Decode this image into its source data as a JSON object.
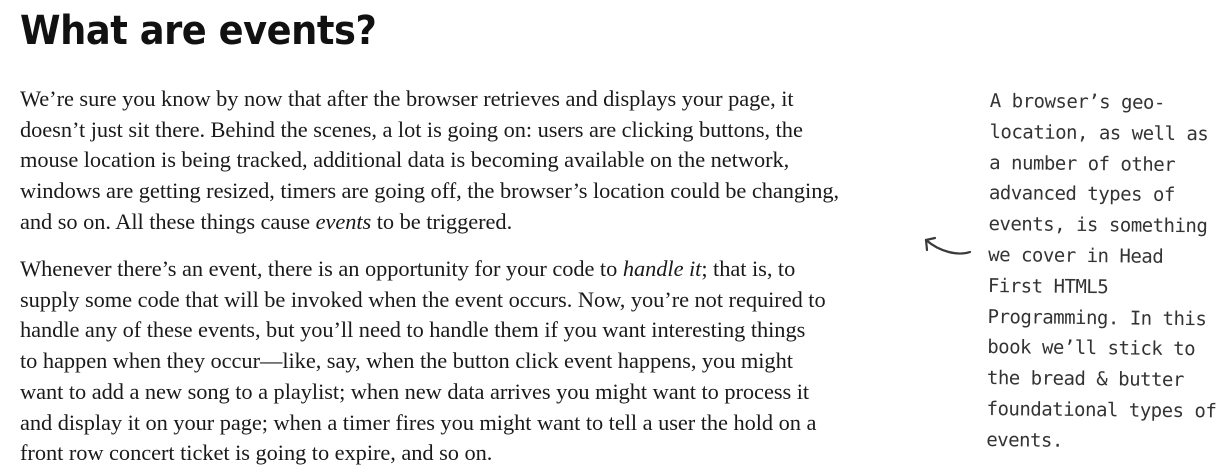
{
  "page": {
    "title": "What are events?"
  },
  "paragraph_1": {
    "lines": [
      "We’re sure you know by now that after the browser retrieves and displays your page, it",
      "doesn’t just sit there. Behind the scenes, a lot is going on: users are clicking buttons, the",
      "mouse location is being tracked, additional data is becoming available on the network,",
      "windows are getting resized, timers are going off, the browser’s location could be changing,"
    ],
    "last_line_before": "and so on. All these things cause ",
    "last_line_emphasis": "events",
    "last_line_after": " to be triggered."
  },
  "paragraph_2": {
    "first_line_before": "Whenever there’s an event, there is an opportunity for your code to ",
    "first_line_emphasis": "handle it",
    "first_line_after": "; that is, to",
    "lines": [
      "supply some code that will be invoked when the event occurs. Now, you’re not required to",
      "handle any of these events, but you’ll need to handle them if you want interesting things",
      "to happen when they occur—like, say, when the button click event happens, you might",
      "want to add a new song to a playlist; when new data arrives you might want to process it",
      "and display it on your page; when a timer fires you might want to tell a user the hold on a",
      "front row concert ticket is going to expire, and so on."
    ]
  },
  "margin_note": {
    "lines": [
      "A browser’s geo-",
      "location, as well as",
      "a number of other",
      "advanced types of",
      "events, is something",
      "we cover in Head",
      "First HTML5",
      "Programming. In this",
      "book we’ll stick to",
      "the bread & butter",
      "foundational types of",
      "events."
    ]
  },
  "icons": {
    "annotation_arrow": "curved-arrow-icon"
  }
}
